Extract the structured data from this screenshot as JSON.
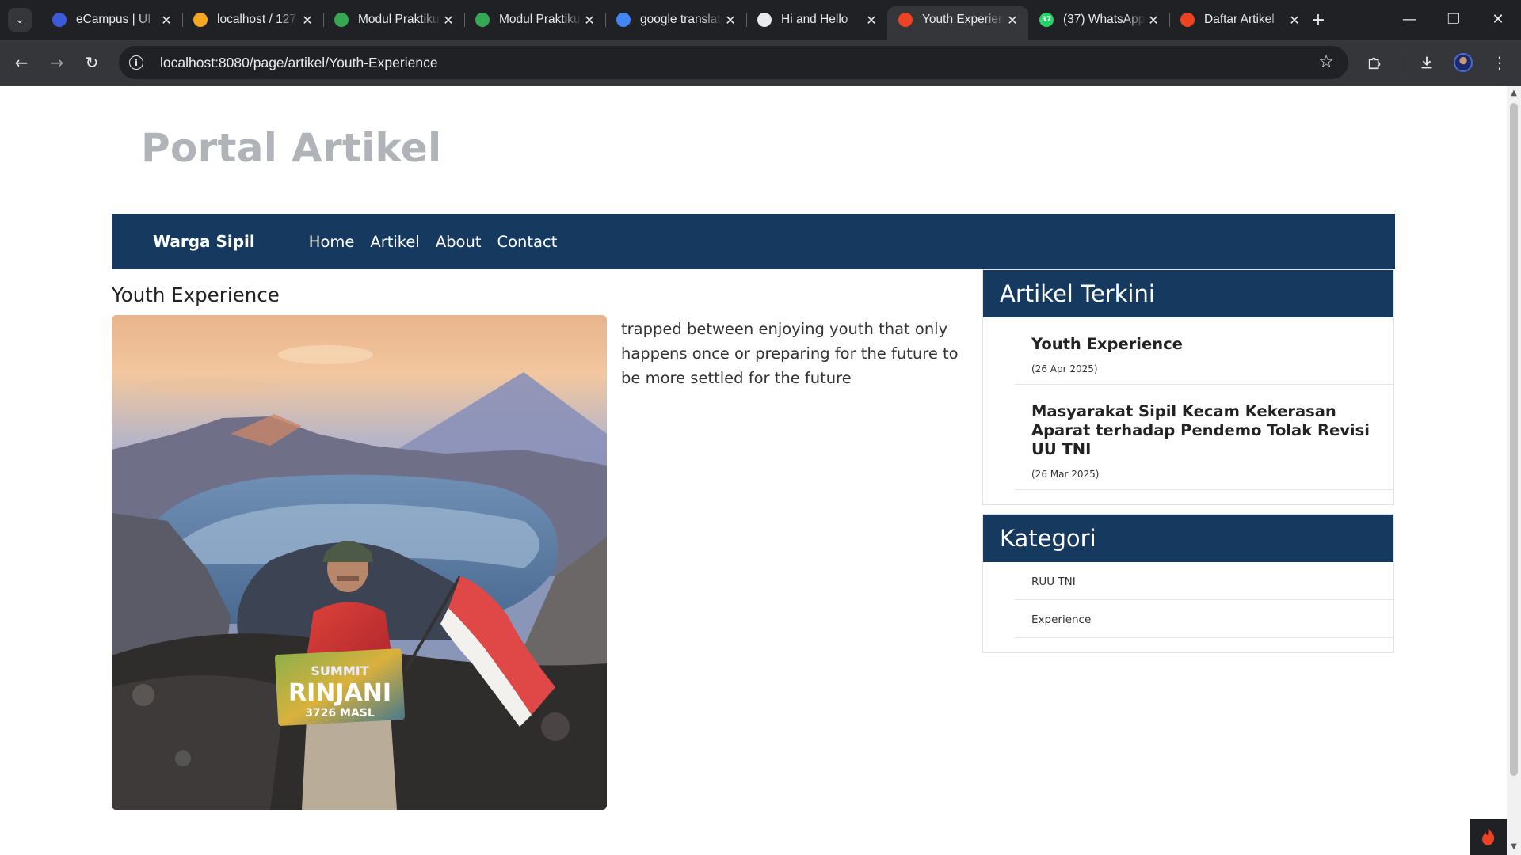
{
  "browser": {
    "tabs": [
      {
        "title": "eCampus | UI",
        "icon": "ecampus-icon",
        "color": "#3b5bdb"
      },
      {
        "title": "localhost / 127",
        "icon": "phpmyadmin-icon",
        "color": "#f5a623"
      },
      {
        "title": "Modul Praktikum",
        "icon": "google-drive-icon",
        "color": "#34a853"
      },
      {
        "title": "Modul Praktikum",
        "icon": "google-drive-icon",
        "color": "#34a853"
      },
      {
        "title": "google translate",
        "icon": "google-icon",
        "color": "#4285f4"
      },
      {
        "title": "Hi and Hello",
        "icon": "chatgpt-icon",
        "color": "#e8eaed"
      },
      {
        "title": "Youth Experience",
        "icon": "codeigniter-icon",
        "color": "#ee4323",
        "active": true
      },
      {
        "title": "(37) WhatsApp",
        "icon": "whatsapp-icon",
        "color": "#25d366",
        "badge": "37"
      },
      {
        "title": "Daftar Artikel",
        "icon": "codeigniter-icon",
        "color": "#ee4323"
      }
    ],
    "url": "localhost:8080/page/artikel/Youth-Experience"
  },
  "site": {
    "title": "Portal Artikel",
    "brand": "Warga Sipil",
    "nav": [
      "Home",
      "Artikel",
      "About",
      "Contact"
    ]
  },
  "article": {
    "title": "Youth Experience",
    "body": "trapped between enjoying youth that only happens once or preparing for the future to be more settled for the future",
    "photo_sign_line1": "SUMMIT",
    "photo_sign_line2": "RINJANI",
    "photo_sign_line3": "3726 MASL"
  },
  "sidebar": {
    "recent": {
      "heading": "Artikel Terkini",
      "items": [
        {
          "title": "Youth Experience",
          "date": "(26 Apr 2025)"
        },
        {
          "title": "Masyarakat Sipil Kecam Kekerasan Aparat terhadap Pendemo Tolak Revisi UU TNI",
          "date": "(26 Mar 2025)"
        }
      ]
    },
    "categories": {
      "heading": "Kategori",
      "items": [
        "RUU TNI",
        "Experience"
      ]
    }
  }
}
